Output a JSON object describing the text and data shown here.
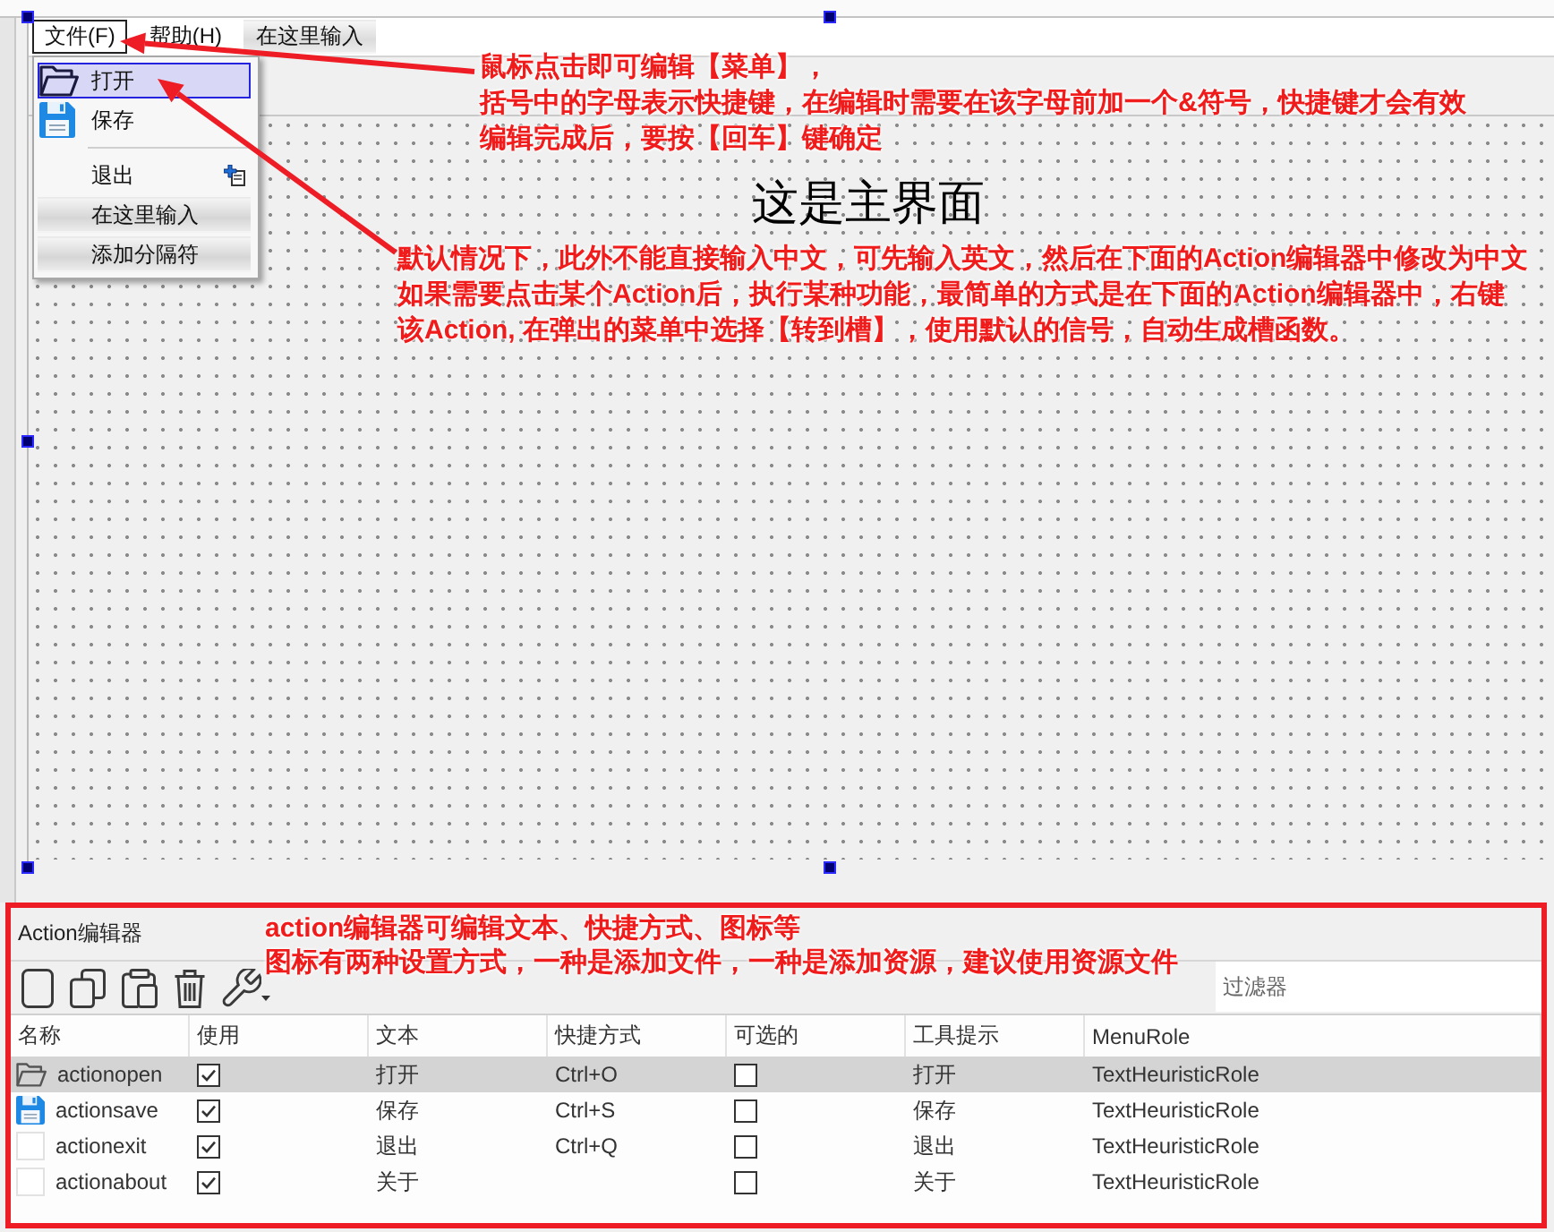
{
  "menu_bar": {
    "items": [
      {
        "kind": "menu",
        "label": "文件(F)",
        "selected": true
      },
      {
        "kind": "menu",
        "label": "帮助(H)",
        "selected": false
      },
      {
        "kind": "placeholder",
        "label": "在这里输入",
        "selected": false
      }
    ]
  },
  "dropdown": {
    "items": [
      {
        "kind": "action",
        "label": "打开",
        "selected": true,
        "submenu_indicator": false
      },
      {
        "kind": "action",
        "label": "保存",
        "selected": false,
        "submenu_indicator": false
      },
      {
        "kind": "separator"
      },
      {
        "kind": "action",
        "label": "退出",
        "selected": false,
        "submenu_indicator": true
      },
      {
        "kind": "placeholder",
        "label": "在这里输入",
        "selected": false
      },
      {
        "kind": "placeholder",
        "label": "添加分隔符",
        "selected": false
      }
    ]
  },
  "main_label": "这是主界面",
  "annotations": [
    {
      "lines": [
        "鼠标点击即可编辑【菜单】，",
        "括号中的字母表示快捷键，在编辑时需要在该字母前加一个&符号，快捷键才会有效",
        "编辑完成后，要按【回车】键确定"
      ]
    },
    {
      "lines": [
        "默认情况下，此外不能直接输入中文，可先输入英文，然后在下面的Action编辑器中修改为中文",
        "如果需要点击某个Action后，执行某种功能，最简单的方式是在下面的Action编辑器中，右键",
        "该Action, 在弹出的菜单中选择【转到槽】，使用默认的信号，自动生成槽函数。"
      ]
    },
    {
      "lines": [
        "action编辑器可编辑文本、快捷方式、图标等",
        "图标有两种设置方式，一种是添加文件，一种是添加资源，建议使用资源文件"
      ]
    }
  ],
  "action_editor": {
    "title": "Action编辑器",
    "filter": {
      "placeholder": "过滤器"
    },
    "columns": [
      "名称",
      "使用",
      "文本",
      "快捷方式",
      "可选的",
      "工具提示",
      "MenuRole"
    ],
    "rows": [
      {
        "name": "actionopen",
        "used": true,
        "text": "打开",
        "shortcut": "Ctrl+O",
        "checkable": false,
        "tooltip": "打开",
        "menu_role": "TextHeuristicRole",
        "selected": true
      },
      {
        "name": "actionsave",
        "used": true,
        "text": "保存",
        "shortcut": "Ctrl+S",
        "checkable": false,
        "tooltip": "保存",
        "menu_role": "TextHeuristicRole",
        "selected": false
      },
      {
        "name": "actionexit",
        "used": true,
        "text": "退出",
        "shortcut": "Ctrl+Q",
        "checkable": false,
        "tooltip": "退出",
        "menu_role": "TextHeuristicRole",
        "selected": false
      },
      {
        "name": "actionabout",
        "used": true,
        "text": "关于",
        "checkable": false,
        "tooltip": "关于",
        "menu_role": "TextHeuristicRole",
        "selected": false
      }
    ]
  }
}
